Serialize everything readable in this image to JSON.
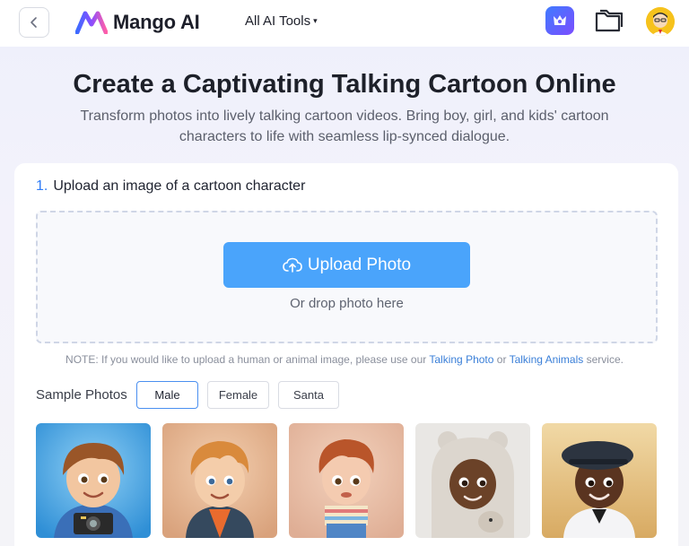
{
  "header": {
    "logo_text": "Mango AI",
    "tools_menu_label": "All AI Tools",
    "caret": "▾"
  },
  "hero": {
    "title": "Create a Captivating Talking Cartoon Online",
    "subtitle_line1": "Transform photos into lively talking cartoon videos. Bring boy, girl, and kids' cartoon",
    "subtitle_line2": "characters to life with seamless lip-synced dialogue."
  },
  "upload": {
    "step_number": "1.",
    "step_label": "Upload an image of a cartoon character",
    "button_label": "Upload Photo",
    "drop_hint": "Or drop photo here"
  },
  "note": {
    "prefix": "NOTE: If you would like to upload a human or animal image, please use our",
    "link1": "Talking Photo",
    "middle": "or",
    "link2": "Talking Animals",
    "suffix": "service."
  },
  "samples": {
    "label": "Sample Photos",
    "tabs": [
      "Male",
      "Female",
      "Santa"
    ],
    "active_tab": "Male"
  },
  "colors": {
    "accent": "#4aa4fb",
    "link": "#3a7fd8",
    "step_number": "#2f7cf6"
  },
  "icons": [
    "chevron-left-icon",
    "mango-logo-icon",
    "crown-app-icon",
    "folder-icon",
    "cloud-upload-icon"
  ]
}
